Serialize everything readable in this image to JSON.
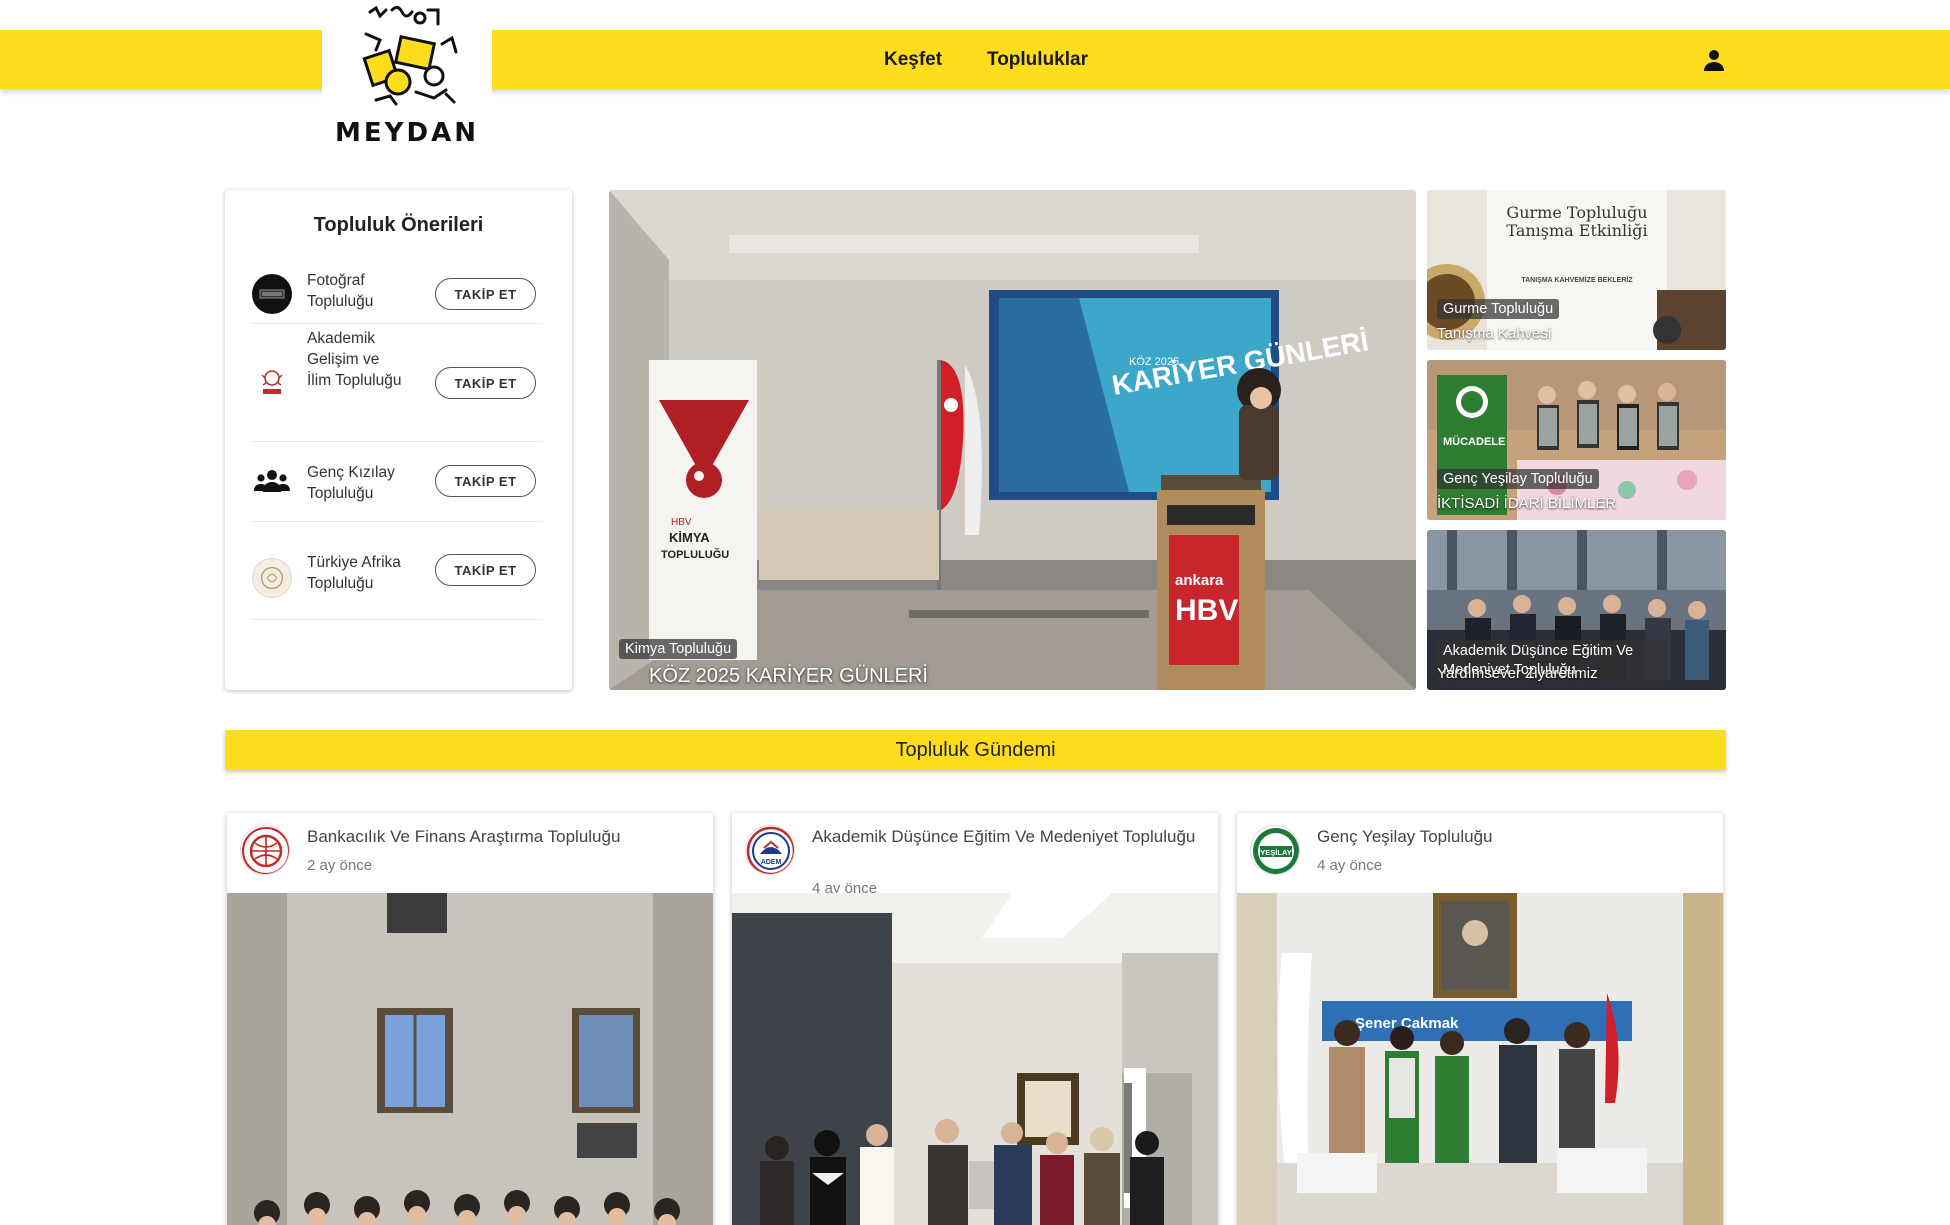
{
  "header": {
    "logo_text": "MEYDAN",
    "nav": [
      "Keşfet",
      "Topluluklar"
    ],
    "brand_color": "#fedd1d"
  },
  "suggestions": {
    "title": "Topluluk Önerileri",
    "follow_label": "TAKİP ET",
    "items": [
      {
        "name": "Fotoğraf Topluluğu"
      },
      {
        "name": "Akademik Gelişim ve İlim Topluluğu"
      },
      {
        "name": "Genç Kızılay Topluluğu"
      },
      {
        "name": "Türkiye Afrika Topluluğu"
      }
    ]
  },
  "hero": {
    "main": {
      "community": "Kimya Topluluğu",
      "title": "KÖZ 2025 KARİYER GÜNLERİ",
      "image_text": {
        "slide": "KARİYER GÜNLERİ",
        "slide_top": "KÖZ 2025",
        "banner_brand": "HBV",
        "banner_sub": "KİMYA TOPLULUĞU",
        "podium": "ankara HBV"
      }
    },
    "side": [
      {
        "community": "Gurme Topluluğu",
        "title": "Tanışma Kahvesi",
        "image_text": {
          "line1": "Gurme Topluluğu",
          "line2": "Tanışma Etkinliği",
          "line3": "TANIŞMA KAHVEMİZE BEKLERİZ"
        }
      },
      {
        "community": "Genç Yeşilay Topluluğu",
        "title": "İKTİSADİ İDARİ BİLİMLER",
        "image_text": {
          "line1": "MÜCADELE"
        }
      },
      {
        "community": "Akademik Düşünce Eğitim Ve Medeniyet Topluluğu",
        "title": "Yardımsever Ziyaretimiz"
      }
    ]
  },
  "feed": {
    "banner": "Topluluk Gündemi",
    "posts": [
      {
        "community": "Bankacılık Ve Finans Araştırma Topluluğu",
        "time": "2 ay önce"
      },
      {
        "community": "Akademik Düşünce Eğitim Ve Medeniyet Topluluğu",
        "time": "4 ay önce",
        "avatar_text": "ADEM"
      },
      {
        "community": "Genç Yeşilay Topluluğu",
        "time": "4 ay önce",
        "avatar_text": "YEŞİLAY",
        "image_text": "Şener Çakmak"
      }
    ]
  }
}
